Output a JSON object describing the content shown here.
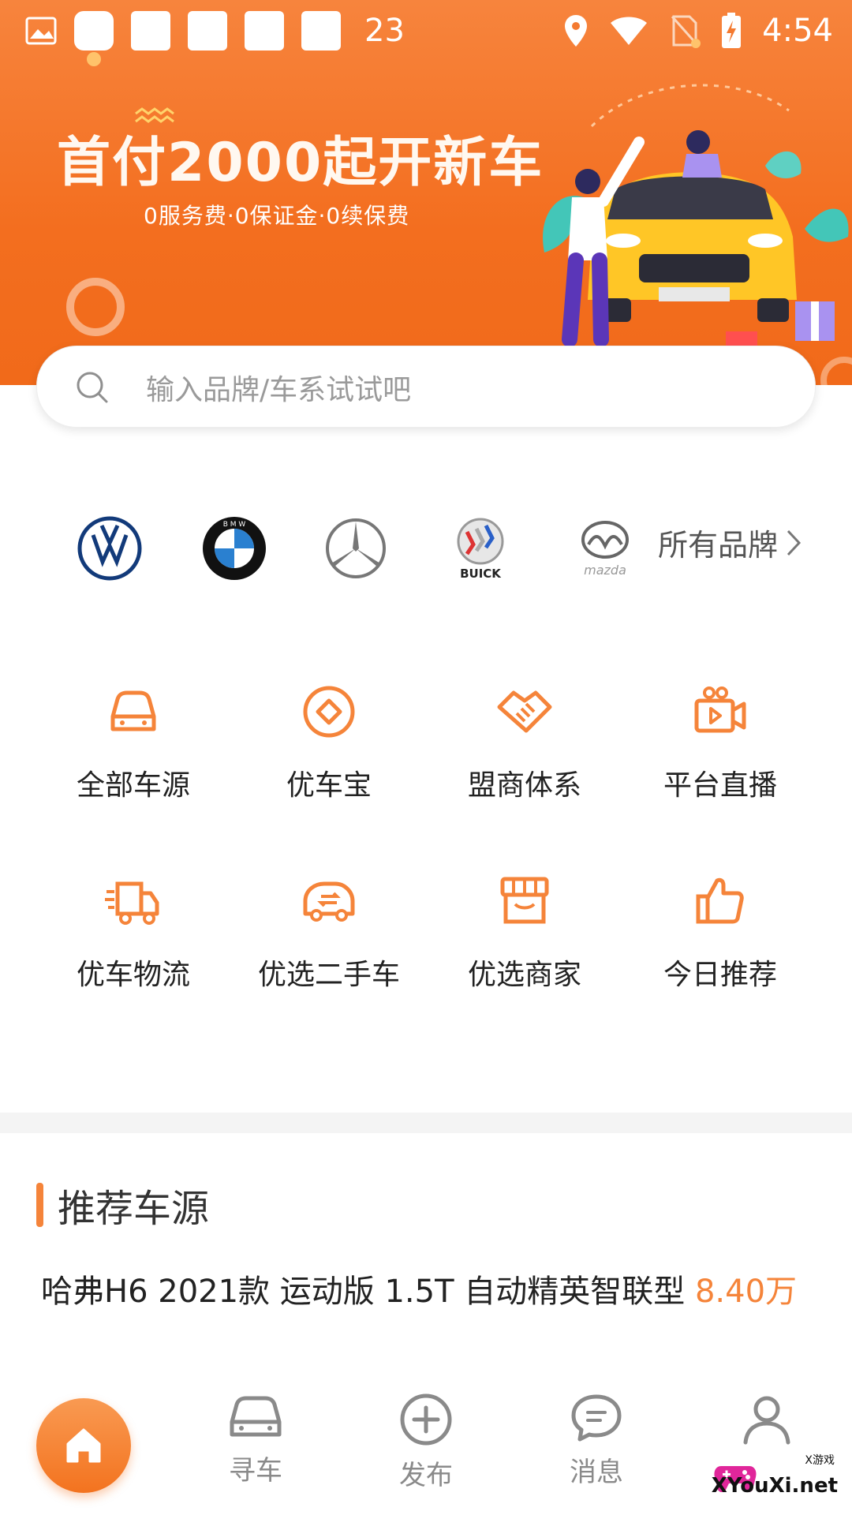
{
  "status_bar": {
    "notification_count": "23",
    "time": "4:54"
  },
  "banner": {
    "title": "首付2000起开新车",
    "subtitle": "0服务费·0保证金·0续保费"
  },
  "search": {
    "placeholder": "输入品牌/车系试试吧"
  },
  "brands": {
    "items": [
      {
        "name": "volkswagen-logo"
      },
      {
        "name": "bmw-logo",
        "text": "B M W"
      },
      {
        "name": "mercedes-logo"
      },
      {
        "name": "buick-logo",
        "text": "BUICK"
      },
      {
        "name": "mazda-logo",
        "text": "mazda"
      }
    ],
    "all_label": "所有品牌"
  },
  "features": {
    "items": [
      {
        "label": "全部车源",
        "icon": "car-icon"
      },
      {
        "label": "优车宝",
        "icon": "diamond-coin-icon"
      },
      {
        "label": "盟商体系",
        "icon": "handshake-icon"
      },
      {
        "label": "平台直播",
        "icon": "video-camera-icon"
      },
      {
        "label": "优车物流",
        "icon": "truck-icon"
      },
      {
        "label": "优选二手车",
        "icon": "used-car-icon"
      },
      {
        "label": "优选商家",
        "icon": "store-icon"
      },
      {
        "label": "今日推荐",
        "icon": "thumbs-up-icon"
      }
    ]
  },
  "recommend": {
    "title": "推荐车源",
    "item_title": "哈弗H6  2021款 运动版 1.5T 自动精英智联型",
    "item_price": "8.40万"
  },
  "nav": {
    "items": [
      {
        "label": "寻车",
        "icon": "car-icon"
      },
      {
        "label": "发布",
        "icon": "plus-circle-icon"
      },
      {
        "label": "消息",
        "icon": "chat-bubble-icon"
      },
      {
        "label": "",
        "icon": "user-icon"
      }
    ]
  },
  "watermark": {
    "text": "XYouXi.net",
    "small": "X游戏"
  },
  "colors": {
    "accent": "#f5843a",
    "banner": "#f36e1f",
    "nav_inactive": "#8a8a8a"
  }
}
